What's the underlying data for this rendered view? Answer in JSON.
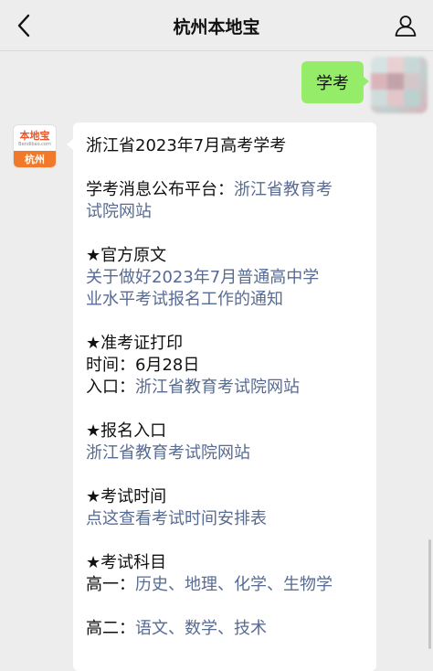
{
  "header": {
    "title": "杭州本地宝",
    "back_icon": "chevron-left-icon",
    "profile_icon": "person-icon"
  },
  "outgoing": {
    "text": "学考"
  },
  "bot": {
    "avatar_logo_text": "本地宝",
    "avatar_logo_sub": "Bendibao.com",
    "avatar_city": "杭州"
  },
  "message": {
    "title": "浙江省2023年7月高考学考",
    "platform_label": "学考消息公布平台：",
    "platform_link_1": "浙江省教育考",
    "platform_link_2": "试院网站",
    "official_heading": "★官方原文",
    "official_link_1": "关于做好2023年7月普通高中学",
    "official_link_2": "业水平考试报名工作的通知",
    "ticket_heading": "★准考证打印",
    "ticket_time": "时间：6月28日",
    "ticket_entry_label": "入口：",
    "ticket_entry_link": "浙江省教育考试院网站",
    "signup_heading": "★报名入口",
    "signup_link": "浙江省教育考试院网站",
    "exam_time_heading": "★考试时间",
    "exam_time_link": "点这查看考试时间安排表",
    "subjects_heading": "★考试科目",
    "grade1_label": "高一：",
    "grade1_subjects": "历史、地理、化学、生物学",
    "grade2_label": "高二：",
    "grade2_subjects": "语文、数学、技术"
  },
  "colors": {
    "background": "#ededed",
    "outgoing_bubble": "#95ec69",
    "link": "#576b95",
    "brand_orange": "#f07a2a"
  }
}
